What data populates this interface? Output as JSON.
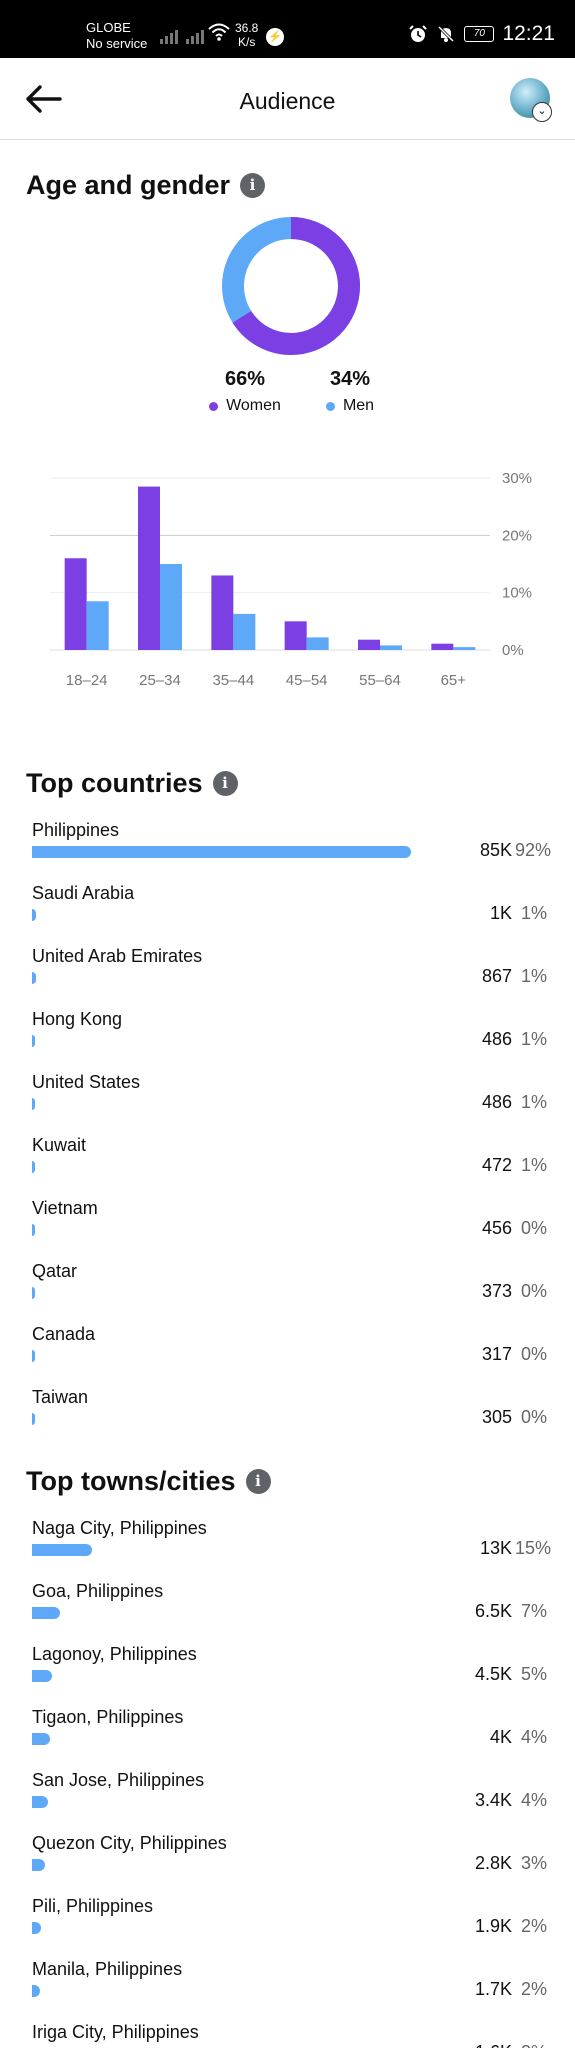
{
  "status_bar": {
    "carrier": "GLOBE",
    "service": "No service",
    "speed_value": "36.8",
    "speed_unit": "K/s",
    "battery": "70",
    "time": "12:21"
  },
  "header": {
    "title": "Audience"
  },
  "age_gender": {
    "title": "Age and gender",
    "info_symbol": "i",
    "women_pct": "66%",
    "women_label": "Women",
    "men_pct": "34%",
    "men_label": "Men",
    "colors": {
      "women": "#7b3fe4",
      "men": "#5ea9f7"
    }
  },
  "chart_data": {
    "type": "bar",
    "categories": [
      "18–24",
      "25–34",
      "35–44",
      "45–54",
      "55–64",
      "65+"
    ],
    "series": [
      {
        "name": "Women",
        "values": [
          16,
          28.5,
          13,
          5,
          1.8,
          1.1
        ]
      },
      {
        "name": "Men",
        "values": [
          8.5,
          15,
          6.3,
          2.2,
          0.8,
          0.5
        ]
      }
    ],
    "ylim": [
      0,
      30
    ],
    "yticks": [
      "30%",
      "20%",
      "10%",
      "0%"
    ],
    "grid": true
  },
  "top_countries": {
    "title": "Top countries",
    "items": [
      {
        "name": "Philippines",
        "value": "85K",
        "pct": "92%",
        "share": 0.92
      },
      {
        "name": "Saudi Arabia",
        "value": "1K",
        "pct": "1%",
        "share": 0.01
      },
      {
        "name": "United Arab Emirates",
        "value": "867",
        "pct": "1%",
        "share": 0.009
      },
      {
        "name": "Hong Kong",
        "value": "486",
        "pct": "1%",
        "share": 0.005
      },
      {
        "name": "United States",
        "value": "486",
        "pct": "1%",
        "share": 0.005
      },
      {
        "name": "Kuwait",
        "value": "472",
        "pct": "1%",
        "share": 0.005
      },
      {
        "name": "Vietnam",
        "value": "456",
        "pct": "0%",
        "share": 0.005
      },
      {
        "name": "Qatar",
        "value": "373",
        "pct": "0%",
        "share": 0.004
      },
      {
        "name": "Canada",
        "value": "317",
        "pct": "0%",
        "share": 0.003
      },
      {
        "name": "Taiwan",
        "value": "305",
        "pct": "0%",
        "share": 0.003
      }
    ]
  },
  "top_cities": {
    "title": "Top towns/cities",
    "items": [
      {
        "name": "Naga City, Philippines",
        "value": "13K",
        "pct": "15%",
        "share": 0.15
      },
      {
        "name": "Goa, Philippines",
        "value": "6.5K",
        "pct": "7%",
        "share": 0.07
      },
      {
        "name": "Lagonoy, Philippines",
        "value": "4.5K",
        "pct": "5%",
        "share": 0.05
      },
      {
        "name": "Tigaon, Philippines",
        "value": "4K",
        "pct": "4%",
        "share": 0.045
      },
      {
        "name": "San Jose, Philippines",
        "value": "3.4K",
        "pct": "4%",
        "share": 0.04
      },
      {
        "name": "Quezon City, Philippines",
        "value": "2.8K",
        "pct": "3%",
        "share": 0.032
      },
      {
        "name": "Pili, Philippines",
        "value": "1.9K",
        "pct": "2%",
        "share": 0.022
      },
      {
        "name": "Manila, Philippines",
        "value": "1.7K",
        "pct": "2%",
        "share": 0.02
      },
      {
        "name": "Iriga City, Philippines",
        "value": "1.6K",
        "pct": "2%",
        "share": 0.018
      }
    ]
  }
}
